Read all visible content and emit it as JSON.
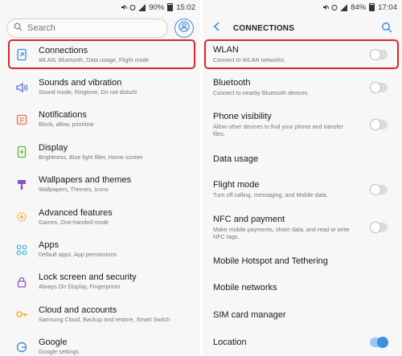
{
  "left": {
    "status": {
      "battery": "90%",
      "time": "15:02"
    },
    "search": {
      "placeholder": "Search"
    },
    "items": [
      {
        "title": "Connections",
        "subtitle": "WLAN, Bluetooth, Data usage, Flight mode",
        "icon": "connections-icon",
        "color": "#3b8ee0",
        "highlighted": true
      },
      {
        "title": "Sounds and vibration",
        "subtitle": "Sound mode, Ringtone, Do not disturb",
        "icon": "speaker-icon",
        "color": "#5a6fd8"
      },
      {
        "title": "Notifications",
        "subtitle": "Block, allow, prioritise",
        "icon": "notifications-icon",
        "color": "#e8734a"
      },
      {
        "title": "Display",
        "subtitle": "Brightness, Blue light filter, Home screen",
        "icon": "display-icon",
        "color": "#5fb33a"
      },
      {
        "title": "Wallpapers and themes",
        "subtitle": "Wallpapers, Themes, Icons",
        "icon": "brush-icon",
        "color": "#8a52c7"
      },
      {
        "title": "Advanced features",
        "subtitle": "Games, One-handed mode",
        "icon": "gear-plus-icon",
        "color": "#f0a21a"
      },
      {
        "title": "Apps",
        "subtitle": "Default apps, App permissions",
        "icon": "apps-icon",
        "color": "#3ab0d8"
      },
      {
        "title": "Lock screen and security",
        "subtitle": "Always On Display, Fingerprints",
        "icon": "lock-icon",
        "color": "#8a52c7"
      },
      {
        "title": "Cloud and accounts",
        "subtitle": "Samsung Cloud, Backup and restore, Smart Switch",
        "icon": "key-icon",
        "color": "#f0a21a"
      },
      {
        "title": "Google",
        "subtitle": "Google settings",
        "icon": "google-icon",
        "color": "#4a8ad8"
      }
    ]
  },
  "right": {
    "status": {
      "battery": "84%",
      "time": "17:04"
    },
    "header": {
      "title": "CONNECTIONS"
    },
    "items": [
      {
        "title": "WLAN",
        "subtitle": "Connect to WLAN networks.",
        "toggle": "off",
        "highlighted": true
      },
      {
        "title": "Bluetooth",
        "subtitle": "Connect to nearby Bluetooth devices.",
        "toggle": "off"
      },
      {
        "title": "Phone visibility",
        "subtitle": "Allow other devices to find your phone and transfer files.",
        "toggle": "off"
      },
      {
        "title": "Data usage",
        "subtitle": "",
        "toggle": "none"
      },
      {
        "title": "Flight mode",
        "subtitle": "Turn off calling, messaging, and Mobile data.",
        "toggle": "off"
      },
      {
        "title": "NFC and payment",
        "subtitle": "Make mobile payments, share data, and read or write NFC tags.",
        "toggle": "off"
      },
      {
        "title": "Mobile Hotspot and Tethering",
        "subtitle": "",
        "toggle": "none"
      },
      {
        "title": "Mobile networks",
        "subtitle": "",
        "toggle": "none"
      },
      {
        "title": "SIM card manager",
        "subtitle": "",
        "toggle": "none"
      },
      {
        "title": "Location",
        "subtitle": "",
        "toggle": "on"
      }
    ]
  },
  "colors": {
    "accent": "#3b8ee0",
    "highlight": "#d9262b"
  }
}
